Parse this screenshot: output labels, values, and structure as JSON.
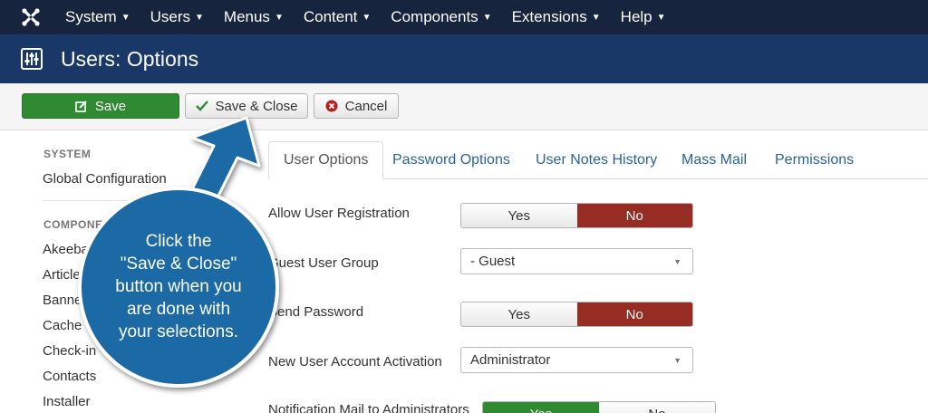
{
  "topnav": {
    "menu": [
      {
        "label": "System"
      },
      {
        "label": "Users"
      },
      {
        "label": "Menus"
      },
      {
        "label": "Content"
      },
      {
        "label": "Components"
      },
      {
        "label": "Extensions"
      },
      {
        "label": "Help"
      }
    ]
  },
  "header": {
    "title": "Users: Options"
  },
  "toolbar": {
    "save_label": "Save",
    "save_close_label": "Save & Close",
    "cancel_label": "Cancel"
  },
  "sidebar": {
    "system_heading": "SYSTEM",
    "global_config": "Global Configuration",
    "components_heading": "COMPONENTS",
    "items": [
      "Akeeba",
      "Articles",
      "Banners",
      "Cache",
      "Check-in",
      "Contacts",
      "Installer"
    ]
  },
  "tabs": [
    {
      "label": "User Options",
      "active": true
    },
    {
      "label": "Password Options"
    },
    {
      "label": "User Notes History"
    },
    {
      "label": "Mass Mail"
    },
    {
      "label": "Permissions"
    }
  ],
  "form": {
    "allow_registration": {
      "label": "Allow User Registration",
      "yes": "Yes",
      "no": "No",
      "value": "No"
    },
    "guest_group": {
      "label": "Guest User Group",
      "value": "- Guest"
    },
    "send_password": {
      "label": "Send Password",
      "yes": "Yes",
      "no": "No",
      "value": "No"
    },
    "activation": {
      "label": "New User Account Activation",
      "value": "Administrator"
    },
    "notification": {
      "label": "Notification Mail to Administrators",
      "yes": "Yes",
      "no": "No",
      "value": "Yes"
    }
  },
  "callout": {
    "lines": [
      "Click the",
      "\"Save & Close\"",
      "button when you",
      "are done with",
      "your selections."
    ]
  },
  "colors": {
    "nav_bg": "#16243e",
    "title_bg": "#1a3867",
    "save_green": "#2f8a32",
    "no_red": "#972c22",
    "callout_blue": "#1b6aa5"
  }
}
